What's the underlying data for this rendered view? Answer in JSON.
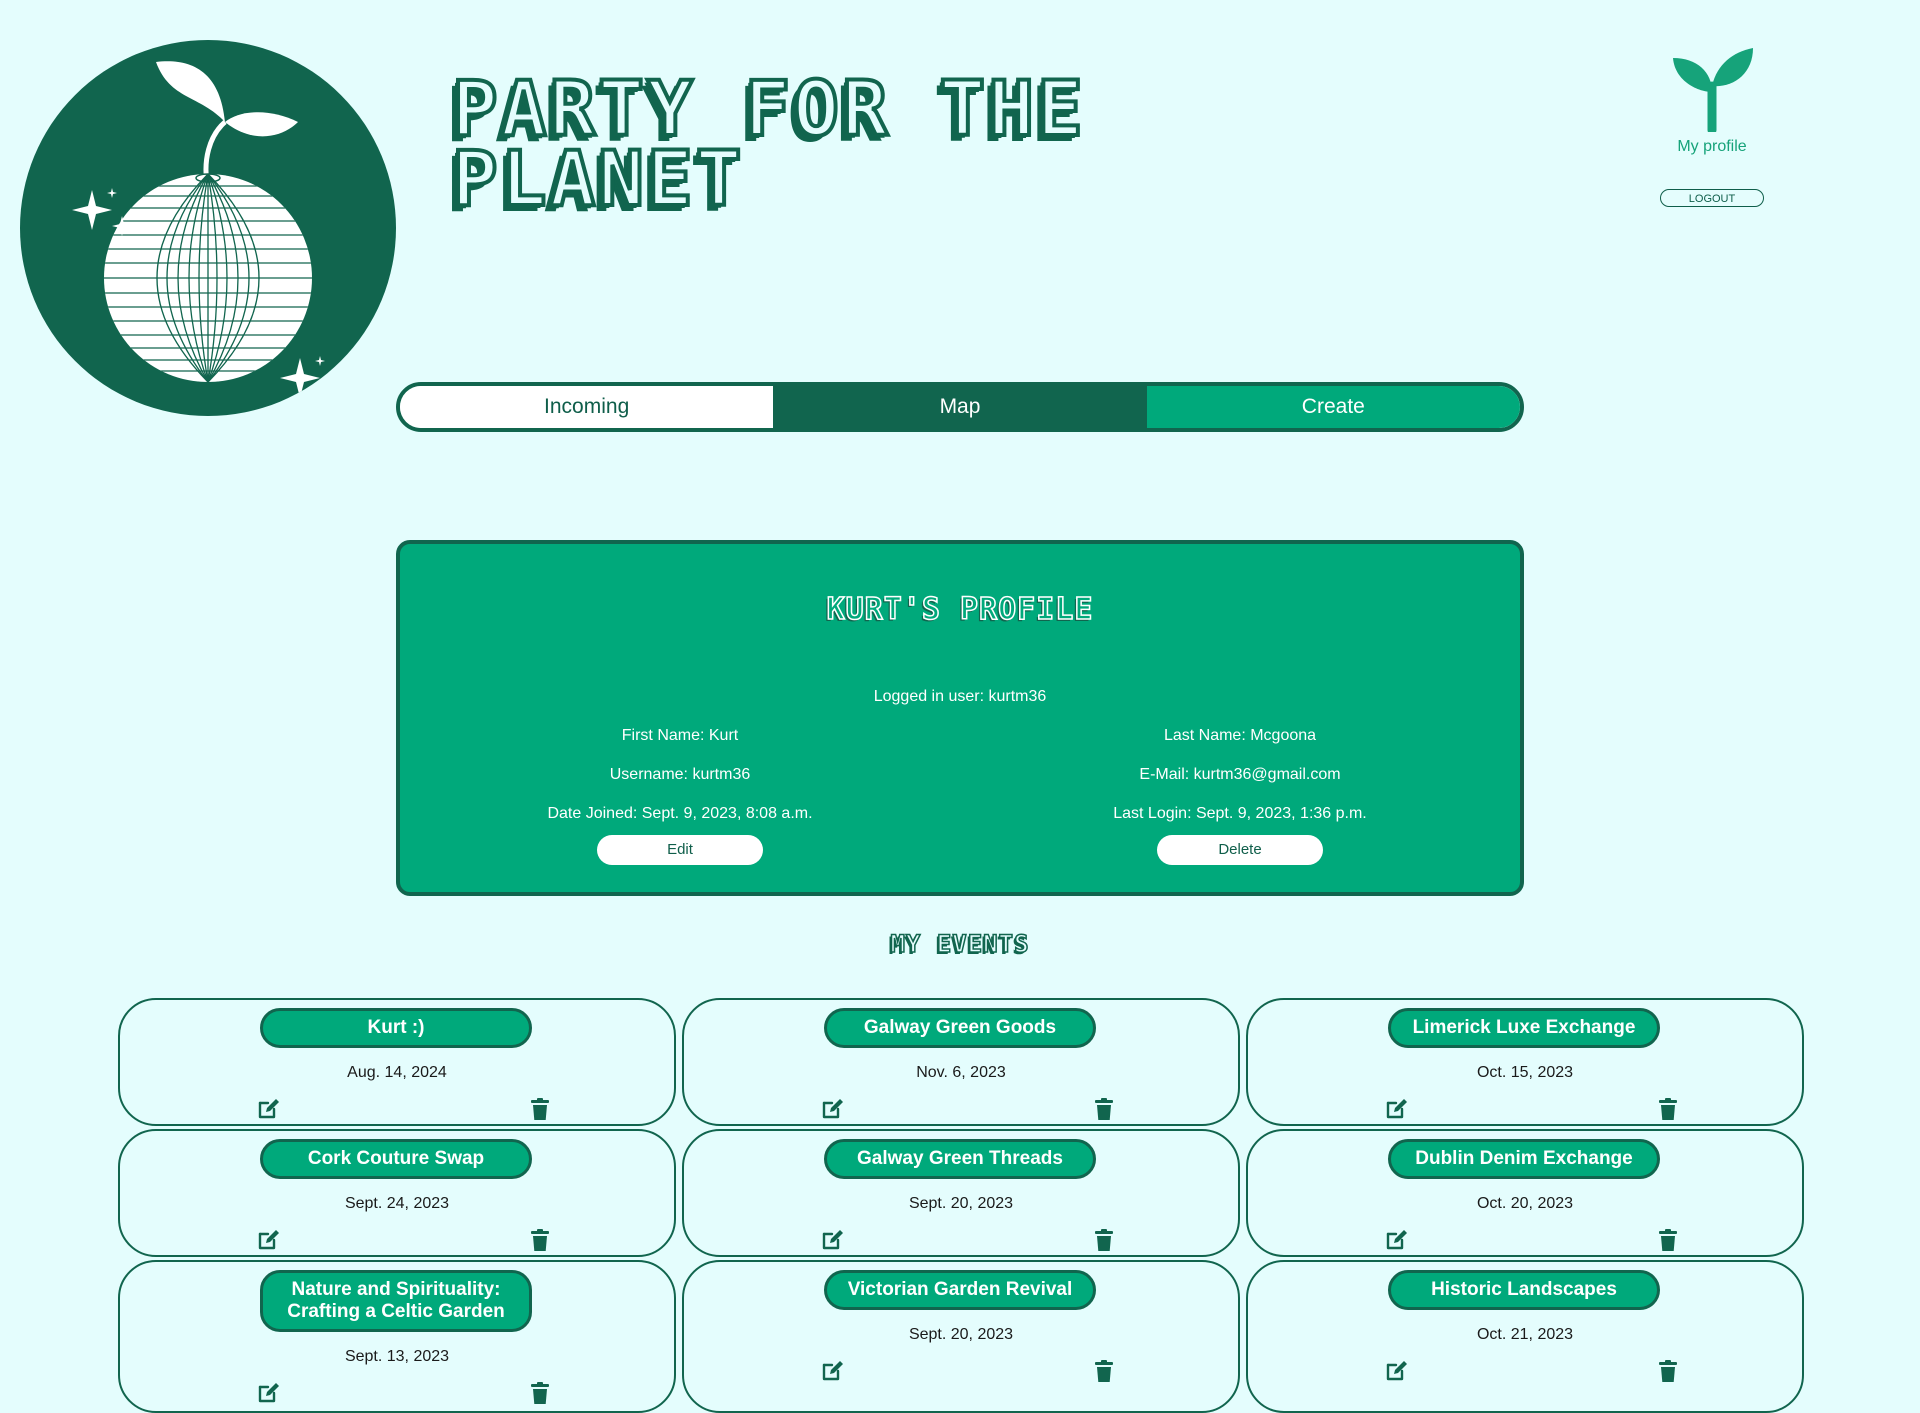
{
  "header": {
    "title": "PARTY FOR THE PLANET",
    "profile_label": "My profile",
    "logout_label": "LOGOUT"
  },
  "nav": {
    "tabs": [
      {
        "label": "Incoming"
      },
      {
        "label": "Map"
      },
      {
        "label": "Create"
      }
    ]
  },
  "profile": {
    "title": "KURT'S PROFILE",
    "logged_in": "Logged in user: kurtm36",
    "first_name": "First Name: Kurt",
    "last_name": "Last Name: Mcgoona",
    "username": "Username: kurtm36",
    "email": "E-Mail: kurtm36@gmail.com",
    "date_joined": "Date Joined: Sept. 9, 2023, 8:08 a.m.",
    "last_login": "Last Login: Sept. 9, 2023, 1:36 p.m.",
    "edit_label": "Edit",
    "delete_label": "Delete"
  },
  "events": {
    "heading": "MY EVENTS",
    "items": [
      {
        "title": "Kurt :)",
        "date": "Aug. 14, 2024"
      },
      {
        "title": "Galway Green Goods",
        "date": "Nov. 6, 2023"
      },
      {
        "title": "Limerick Luxe Exchange",
        "date": "Oct. 15, 2023"
      },
      {
        "title": "Cork Couture Swap",
        "date": "Sept. 24, 2023"
      },
      {
        "title": "Galway Green Threads",
        "date": "Sept. 20, 2023"
      },
      {
        "title": "Dublin Denim Exchange",
        "date": "Oct. 20, 2023"
      },
      {
        "title": "Nature and Spirituality: Crafting a Celtic Garden",
        "date": "Sept. 13, 2023"
      },
      {
        "title": "Victorian Garden Revival",
        "date": "Sept. 20, 2023"
      },
      {
        "title": "Historic Landscapes",
        "date": "Oct. 21, 2023"
      }
    ]
  },
  "colors": {
    "background": "#e4fdfd",
    "dark_green": "#11654e",
    "accent_green": "#00a97b"
  },
  "icons": {
    "logo": "disco-ball-sprout-icon",
    "profile": "sprout-icon",
    "edit": "edit-icon",
    "delete": "trash-icon"
  }
}
